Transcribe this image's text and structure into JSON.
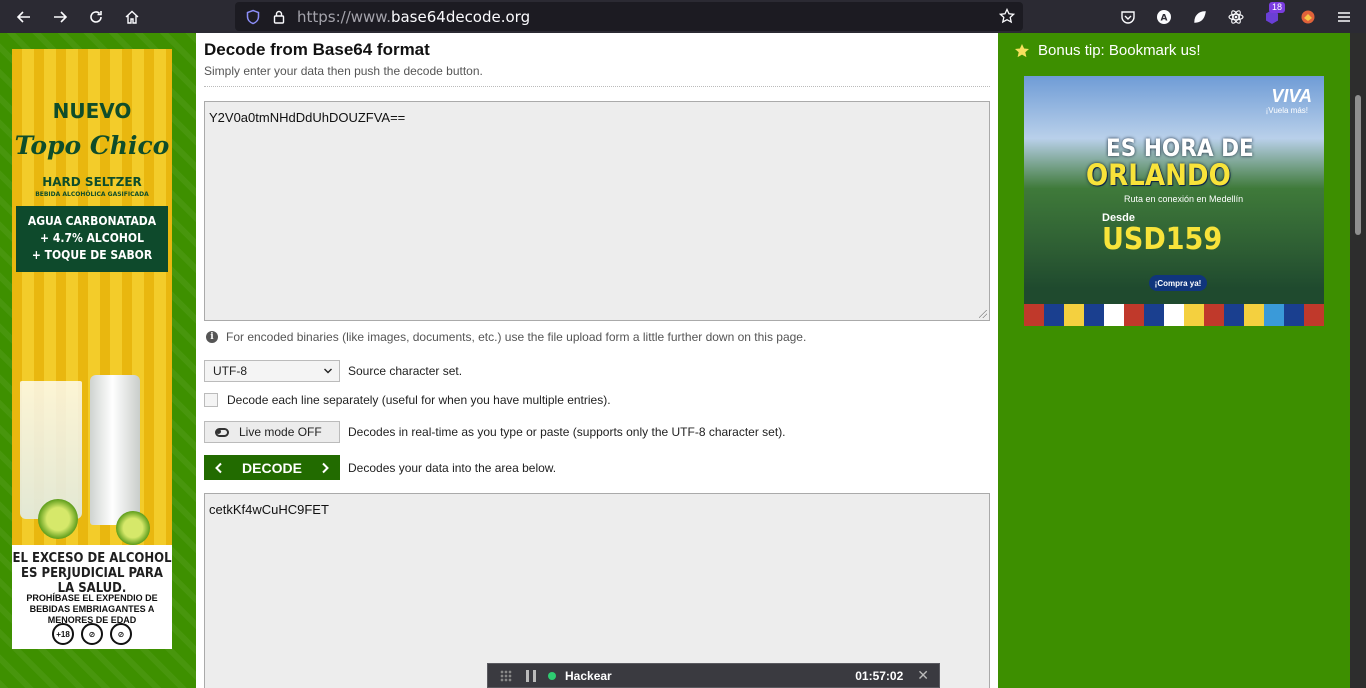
{
  "browser": {
    "url_prefix": "https://www.",
    "url_domain": "base64decode.org",
    "extension_badge": "18"
  },
  "left_ad": {
    "line1": "NUEVO",
    "brand": "Topo Chico",
    "sub1": "HARD SELTZER",
    "sub2": "BEBIDA ALCOHÓLICA GASIFICADA",
    "box_line1": "AGUA CARBONATADA",
    "box_line2": "+ 4.7% ALCOHOL",
    "box_line3": "+ TOQUE DE SABOR",
    "warning": "EL EXCESO DE ALCOHOL ES PERJUDICIAL PARA LA SALUD.",
    "warning2": "PROHÍBASE EL EXPENDIO DE BEBIDAS EMBRIAGANTES A MENORES DE EDAD",
    "icon1": "+18"
  },
  "main": {
    "title": "Decode from Base64 format",
    "subtitle": "Simply enter your data then push the decode button.",
    "input_value": "Y2V0a0tmNHdDdUhDOUZFVA==",
    "upload_note": "For encoded binaries (like images, documents, etc.) use the file upload form a little further down on this page.",
    "charset_value": "UTF-8",
    "charset_label": "Source character set.",
    "each_line_label": "Decode each line separately (useful for when you have multiple entries).",
    "live_mode_label": "Live mode OFF",
    "live_mode_desc": "Decodes in real-time as you type or paste (supports only the UTF-8 character set).",
    "decode_label": "DECODE",
    "decode_desc": "Decodes your data into the area below.",
    "output_value": "cetkKf4wCuHC9FET"
  },
  "right": {
    "bonus_tip": "Bonus tip: Bookmark us!",
    "ad": {
      "brand": "VIVA",
      "brand_sub": "¡Vuela más!",
      "es_hora": "ES HORA DE",
      "city": "ORLANDO",
      "ruta": "Ruta en conexión en Medellín",
      "desde": "Desde",
      "price": "USD159",
      "cta": "¡Compra ya!"
    }
  },
  "overlay": {
    "name": "Hackear",
    "time": "01:57:02"
  },
  "colors": {
    "page_green": "#3a8c00",
    "decode_button": "#226b00"
  }
}
